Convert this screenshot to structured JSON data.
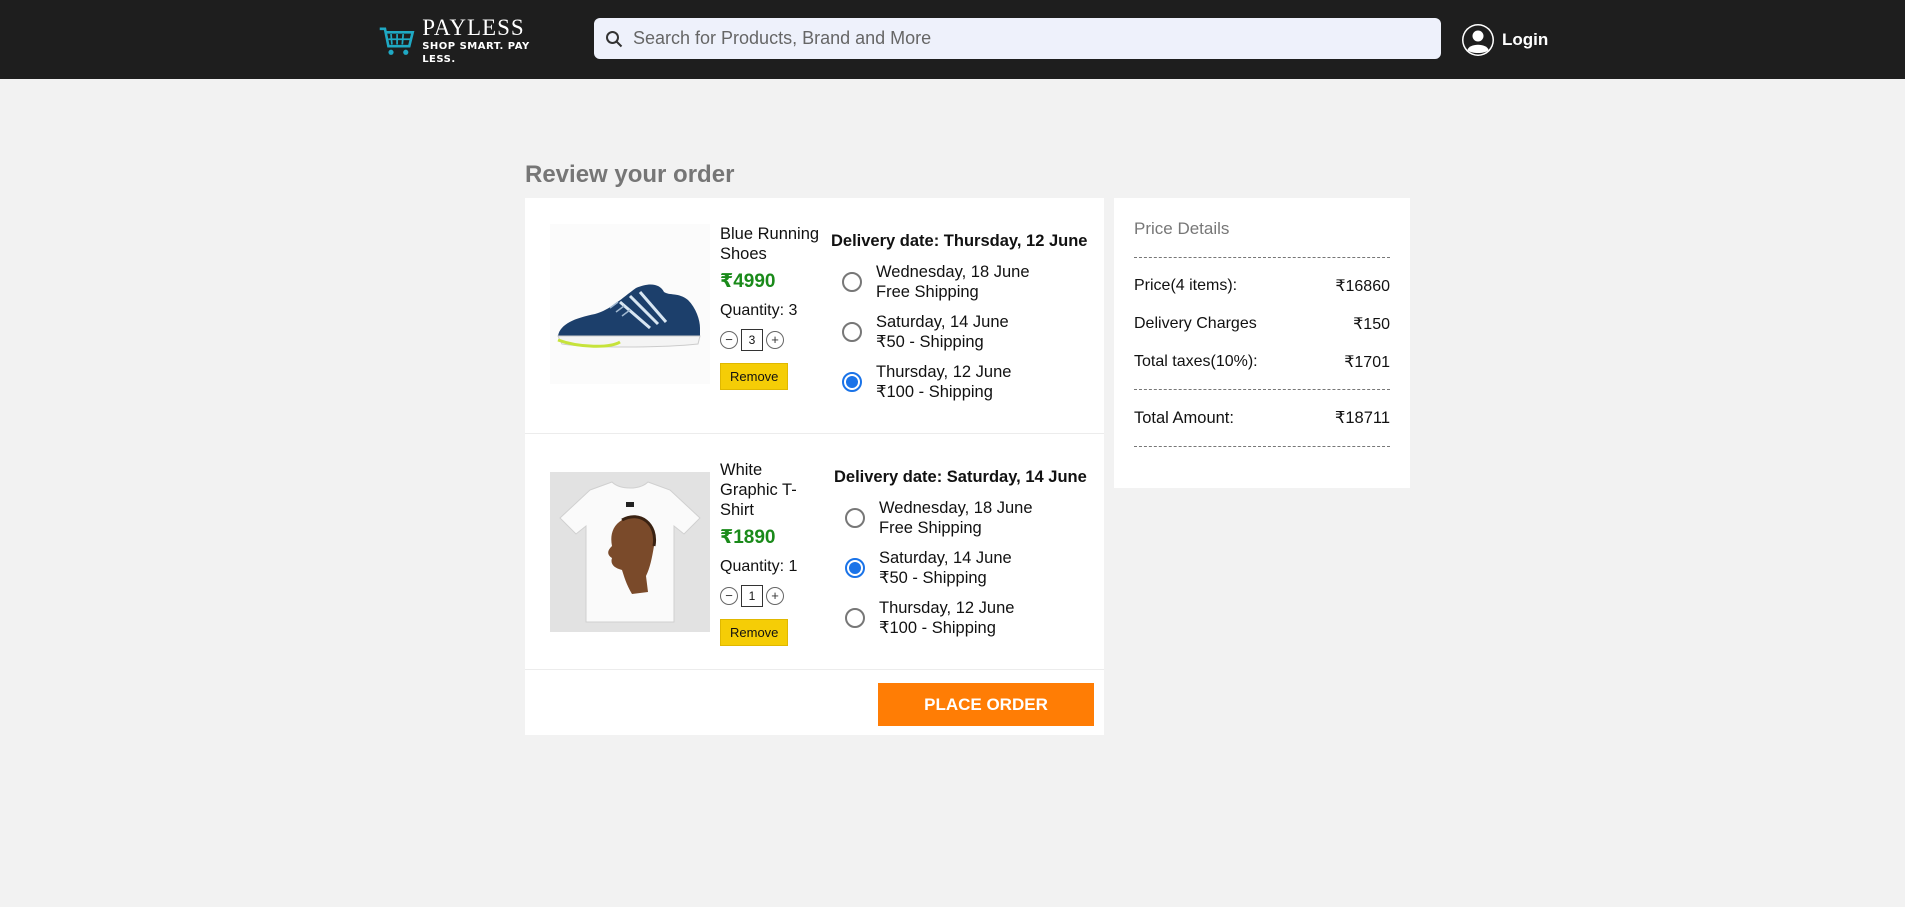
{
  "header": {
    "logo_name": "PAYLESS",
    "logo_tagline": "SHOP SMART. PAY LESS.",
    "search_placeholder": "Search for Products, Brand and More",
    "login_label": "Login"
  },
  "page_title": "Review your order",
  "items": [
    {
      "name": "Blue Running Shoes",
      "price": "₹4990",
      "quantity_label": "Quantity: 3",
      "quantity_value": "3",
      "remove_label": "Remove",
      "delivery_title": "Delivery date: Thursday, 12 June",
      "options": [
        {
          "date": "Wednesday, 18 June",
          "shipping": "Free Shipping",
          "selected": false
        },
        {
          "date": "Saturday, 14 June",
          "shipping": "₹50 - Shipping",
          "selected": false
        },
        {
          "date": "Thursday, 12 June",
          "shipping": "₹100 - Shipping",
          "selected": true
        }
      ]
    },
    {
      "name": "White Graphic T-Shirt",
      "price": "₹1890",
      "quantity_label": "Quantity: 1",
      "quantity_value": "1",
      "remove_label": "Remove",
      "delivery_title": "Delivery date: Saturday, 14 June",
      "options": [
        {
          "date": "Wednesday, 18 June",
          "shipping": "Free Shipping",
          "selected": false
        },
        {
          "date": "Saturday, 14 June",
          "shipping": "₹50 - Shipping",
          "selected": true
        },
        {
          "date": "Thursday, 12 June",
          "shipping": "₹100 - Shipping",
          "selected": false
        }
      ]
    }
  ],
  "place_order_label": "PLACE ORDER",
  "price_details": {
    "title": "Price Details",
    "rows": [
      {
        "label": "Price(4 items):",
        "value": "₹16860"
      },
      {
        "label": "Delivery Charges",
        "value": "₹150"
      },
      {
        "label": "Total taxes(10%):",
        "value": "₹1701"
      }
    ],
    "total_label": "Total Amount:",
    "total_value": "₹18711"
  },
  "colors": {
    "header_bg": "#1e1e1e",
    "price_green": "#1a8a1a",
    "place_order_orange": "#ff7d05",
    "remove_yellow": "#f5cd06",
    "radio_blue": "#1a73e8"
  },
  "icons": {
    "logo": "shopping-cart-icon",
    "search": "search-icon",
    "login": "user-avatar-icon",
    "decrement": "minus-icon",
    "increment": "plus-icon"
  }
}
